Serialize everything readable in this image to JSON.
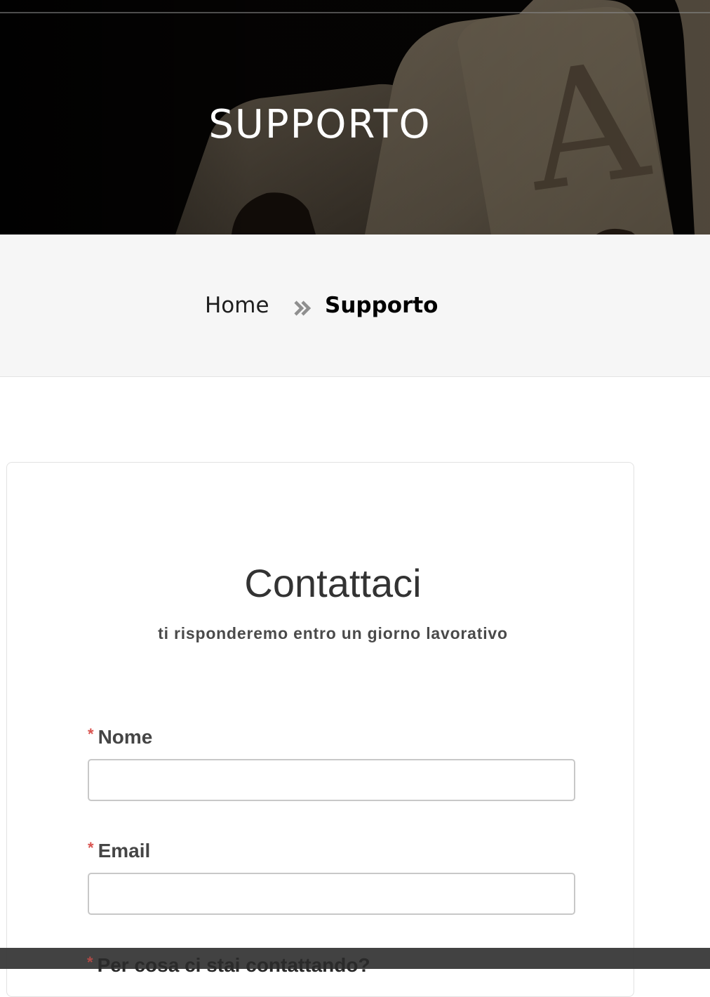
{
  "hero": {
    "title": "SUPPORTO",
    "background": "playing-cards-photo"
  },
  "breadcrumb": {
    "home_label": "Home",
    "separator_icon": "double-chevron-right-icon",
    "current_label": "Supporto"
  },
  "contact_form": {
    "title": "Contattaci",
    "subtitle": "ti risponderemo entro un giorno lavorativo",
    "required_marker": "*",
    "fields": [
      {
        "label": "Nome",
        "value": "",
        "placeholder": ""
      },
      {
        "label": "Email",
        "value": "",
        "placeholder": ""
      },
      {
        "label": "Per cosa ci stai contattando?"
      }
    ]
  },
  "colors": {
    "required": "#d9534f",
    "breadcrumb_bg": "#f6f6f6",
    "text_dark": "#333333"
  }
}
